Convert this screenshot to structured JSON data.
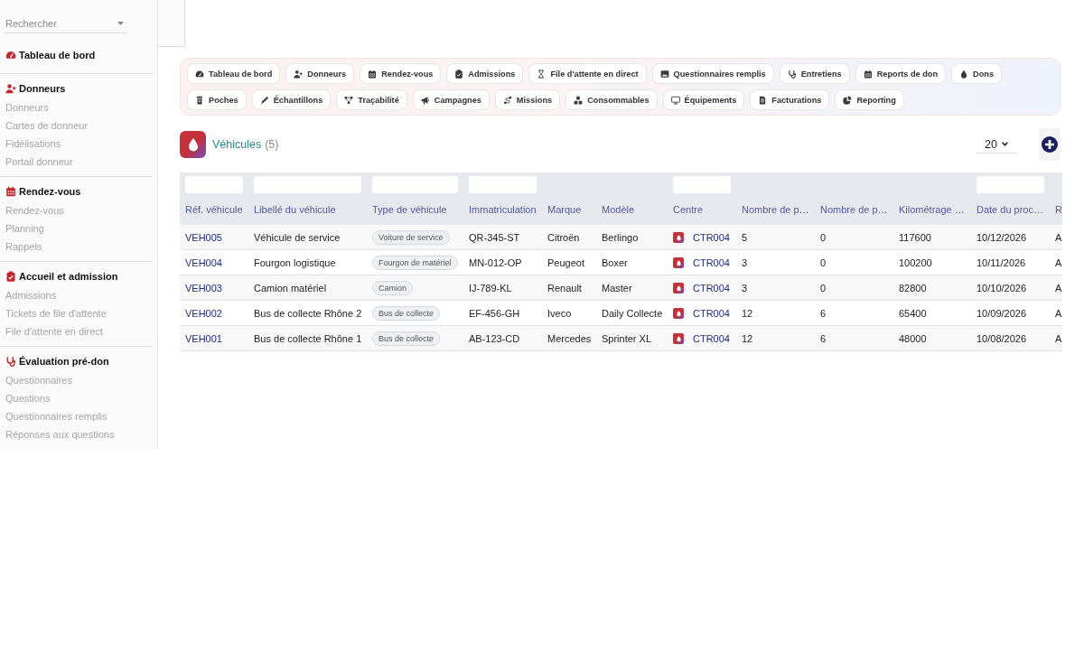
{
  "sidebar": {
    "search": {
      "placeholder": "Rechercher"
    },
    "sections": [
      {
        "title": "Tableau de bord"
      },
      {
        "title": "Donneurs",
        "items": [
          "Donneurs",
          "Cartes de donneur",
          "Fidélisations",
          "Portail donneur"
        ]
      },
      {
        "title": "Rendez-vous",
        "items": [
          "Rendez-vous",
          "Planning",
          "Rappels"
        ]
      },
      {
        "title": "Accueil et admission",
        "items": [
          "Admissions",
          "Tickets de file d'attente",
          "File d'attente en direct"
        ]
      },
      {
        "title": "Évaluation pré-don",
        "items": [
          "Questionnaires",
          "Questions",
          "Questionnaires remplis",
          "Réponses aux questions"
        ]
      }
    ]
  },
  "quick_links": [
    [
      "Tableau de bord",
      "Donneurs",
      "Rendez-vous",
      "Admissions",
      "File d'attente en direct",
      "Questionnaires remplis",
      "Entretiens",
      "Reports de don",
      "Dons"
    ],
    [
      "Poches",
      "Échantillons",
      "Traçabilité",
      "Campagnes",
      "Missions",
      "Consommables",
      "Équipements",
      "Facturations",
      "Reporting"
    ]
  ],
  "page_header": {
    "title": "Véhicules",
    "count": "(5)",
    "page_size": "20"
  },
  "table": {
    "columns": [
      {
        "label": "Réf. véhicule",
        "kind": "link",
        "filterable": true
      },
      {
        "label": "Libellé du véhicule",
        "kind": "text",
        "filterable": true
      },
      {
        "label": "Type de véhicule",
        "kind": "badge",
        "filterable": true
      },
      {
        "label": "Immatriculation",
        "kind": "text",
        "filterable": true
      },
      {
        "label": "Marque",
        "kind": "text",
        "filterable": false
      },
      {
        "label": "Modèle",
        "kind": "text",
        "filterable": false
      },
      {
        "label": "Centre",
        "kind": "centre",
        "filterable": true
      },
      {
        "label": "Nombre de p…",
        "kind": "text",
        "filterable": false
      },
      {
        "label": "Nombre de p…",
        "kind": "text",
        "filterable": false
      },
      {
        "label": "Kilométrage …",
        "kind": "text",
        "filterable": false
      },
      {
        "label": "Date du proc…",
        "kind": "text",
        "filterable": true
      },
      {
        "label": "R",
        "kind": "text",
        "filterable": false
      }
    ],
    "rows": [
      [
        "VEH005",
        "Véhicule de service",
        "Voiture de service",
        "QR-345-ST",
        "Citroën",
        "Berlingo",
        "CTR004",
        "5",
        "0",
        "117600",
        "10/12/2026",
        "A"
      ],
      [
        "VEH004",
        "Fourgon logistique",
        "Fourgon de matériel",
        "MN-012-OP",
        "Peugeot",
        "Boxer",
        "CTR004",
        "3",
        "0",
        "100200",
        "10/11/2026",
        "A"
      ],
      [
        "VEH003",
        "Camion matériel",
        "Camion",
        "IJ-789-KL",
        "Renault",
        "Master",
        "CTR004",
        "3",
        "0",
        "82800",
        "10/10/2026",
        "A"
      ],
      [
        "VEH002",
        "Bus de collecte Rhône 2",
        "Bus de collecte",
        "EF-456-GH",
        "Iveco",
        "Daily Collecte",
        "CTR004",
        "12",
        "6",
        "65400",
        "10/09/2026",
        "A"
      ],
      [
        "VEH001",
        "Bus de collecte Rhône 1",
        "Bus de collecte",
        "AB-123-CD",
        "Mercedes",
        "Sprinter XL",
        "CTR004",
        "12",
        "6",
        "48000",
        "10/08/2026",
        "A"
      ]
    ]
  }
}
